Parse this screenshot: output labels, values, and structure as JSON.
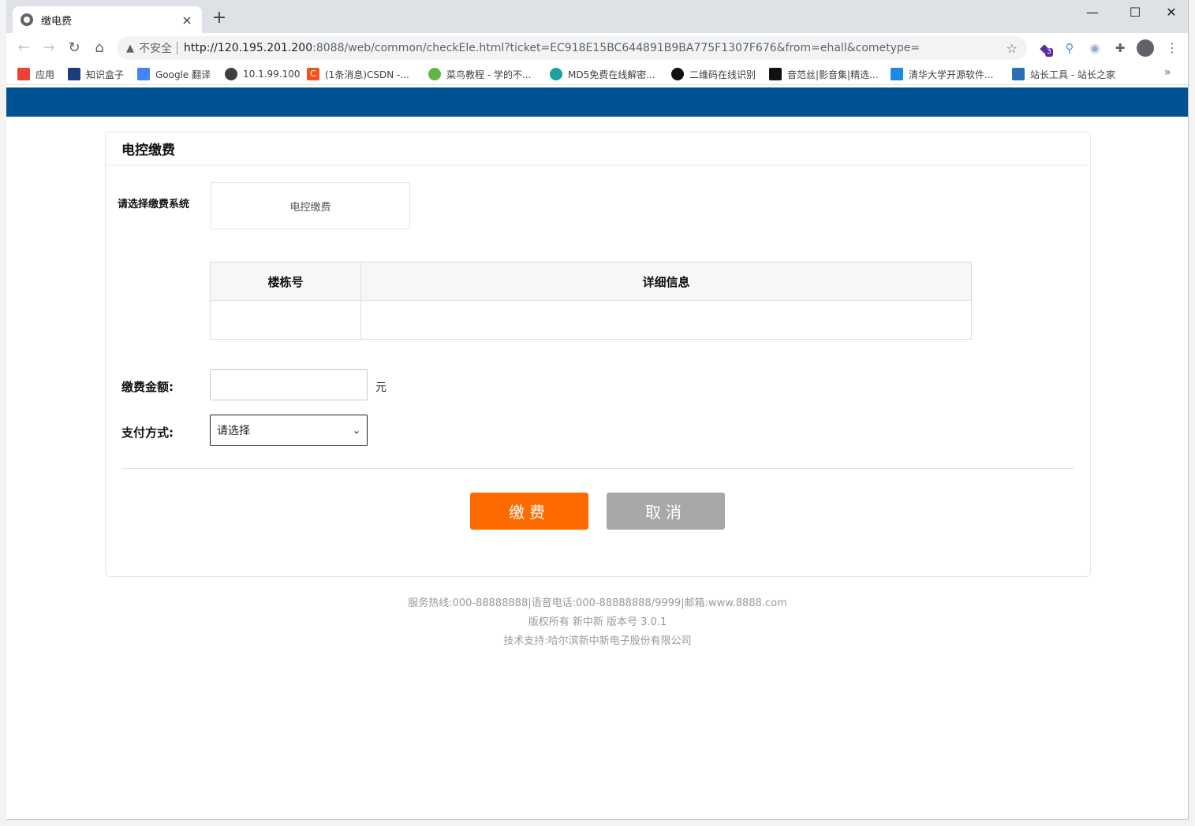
{
  "browser": {
    "tab_title": "缴电费",
    "new_tab": "+",
    "close_tab": "×",
    "window_controls": {
      "minimize": "—",
      "maximize": "☐",
      "close": "✕"
    },
    "security_label": "不安全",
    "url_host": "http://120.195.201.200",
    "url_rest": ":8088/web/common/checkEle.html?ticket=EC918E15BC644891B9BA775F1307F676&from=ehall&cometype=",
    "extension_badge": "3"
  },
  "bookmarks": [
    {
      "label": "应用",
      "icon": "apps-grid-icon",
      "color": "#ea4335"
    },
    {
      "label": "知识盒子",
      "icon": "book-icon",
      "color": "#1a3d7c"
    },
    {
      "label": "Google 翻译",
      "icon": "google-translate-icon",
      "color": "#4285f4"
    },
    {
      "label": "10.1.99.100",
      "icon": "globe-icon",
      "color": "#3c4043"
    },
    {
      "label": "(1条消息)CSDN -...",
      "icon": "csdn-icon",
      "color": "#f4511e"
    },
    {
      "label": "菜鸟教程 - 学的不...",
      "icon": "runoob-icon",
      "color": "#5fb44a"
    },
    {
      "label": "MD5免费在线解密...",
      "icon": "md5-icon",
      "color": "#1aa39a"
    },
    {
      "label": "二维码在线识别",
      "icon": "qrcode-icon",
      "color": "#111111"
    },
    {
      "label": "音范丝|影音集|精选...",
      "icon": "grid-icon",
      "color": "#111111"
    },
    {
      "label": "清华大学开源软件...",
      "icon": "tsinghua-icon",
      "color": "#1e88e5"
    },
    {
      "label": "站长工具 - 站长之家",
      "icon": "chinaz-icon",
      "color": "#2a6fb0"
    }
  ],
  "page": {
    "card_title": "电控缴费",
    "system_label": "请选择缴费系统",
    "system_option": "电控缴费",
    "table_headers": [
      "楼栋号",
      "详细信息"
    ],
    "amount_label": "缴费金额:",
    "amount_value": "",
    "amount_unit": "元",
    "payment_label": "支付方式:",
    "payment_selected": "请选择",
    "pay_button": "缴费",
    "cancel_button": "取消"
  },
  "footer": {
    "line1": "服务热线:000-88888888|语音电话:000-88888888/9999|邮箱:www.8888.com",
    "line2": "版权所有 新中新 版本号 3.0.1",
    "line3": "技术支持:哈尔滨新中新电子股份有限公司"
  },
  "colors": {
    "header_bar": "#015293",
    "pay_button": "#ff6a00",
    "cancel_button": "#a8a8a8"
  }
}
